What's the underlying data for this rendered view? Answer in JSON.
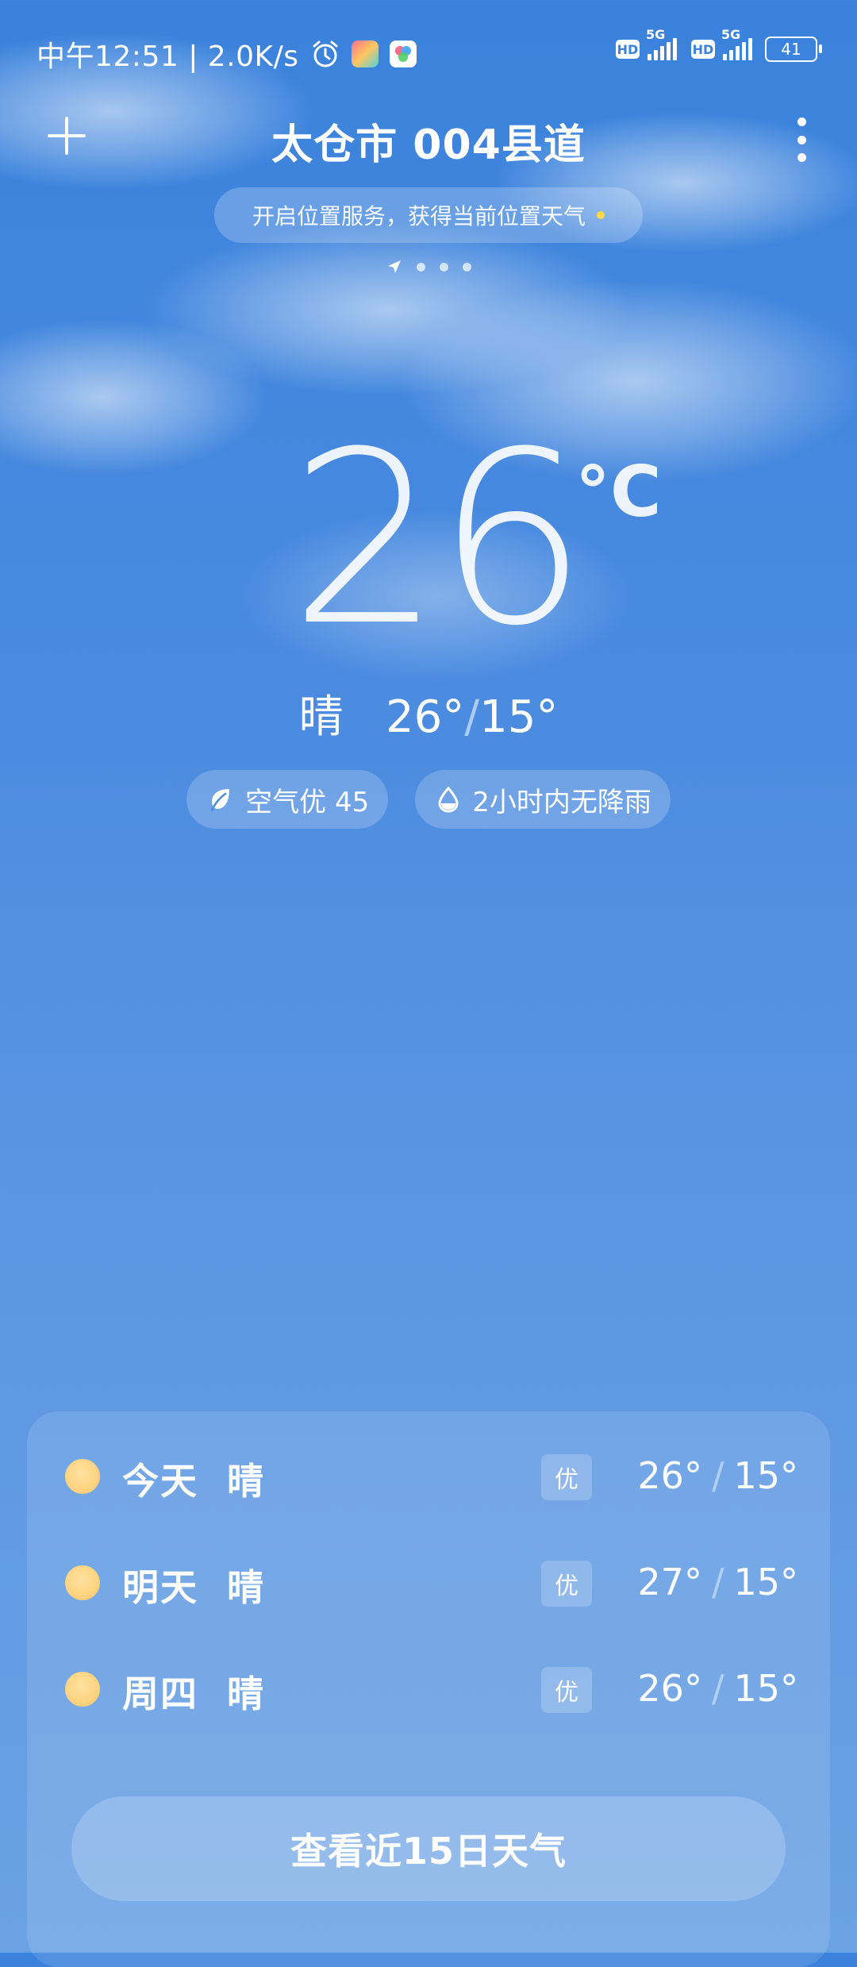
{
  "status_bar": {
    "time_speed": "中午12:51 | 2.0K/s",
    "net1": "5G",
    "net2": "5G",
    "hd": "HD",
    "battery": "41"
  },
  "header": {
    "city": "太仓市 004县道",
    "location_prompt": "开启位置服务，获得当前位置天气"
  },
  "current": {
    "temperature": "26",
    "unit": "°C",
    "condition": "晴",
    "high": "26°",
    "low": "15°",
    "range_separator": "/"
  },
  "chips": {
    "air": "空气优 45",
    "rain": "2小时内无降雨"
  },
  "forecast": [
    {
      "day": "今天",
      "condition": "晴",
      "aqi": "优",
      "high": "26°",
      "low": "15°"
    },
    {
      "day": "明天",
      "condition": "晴",
      "aqi": "优",
      "high": "27°",
      "low": "15°"
    },
    {
      "day": "周四",
      "condition": "晴",
      "aqi": "优",
      "high": "26°",
      "low": "15°"
    }
  ],
  "forecast_button": "查看近15日天气",
  "colors": {
    "sky_top": "#3a82dc",
    "sky_bottom": "#6aa2e4",
    "sun": "#ffd07a",
    "location_dot": "#ffd84a"
  }
}
